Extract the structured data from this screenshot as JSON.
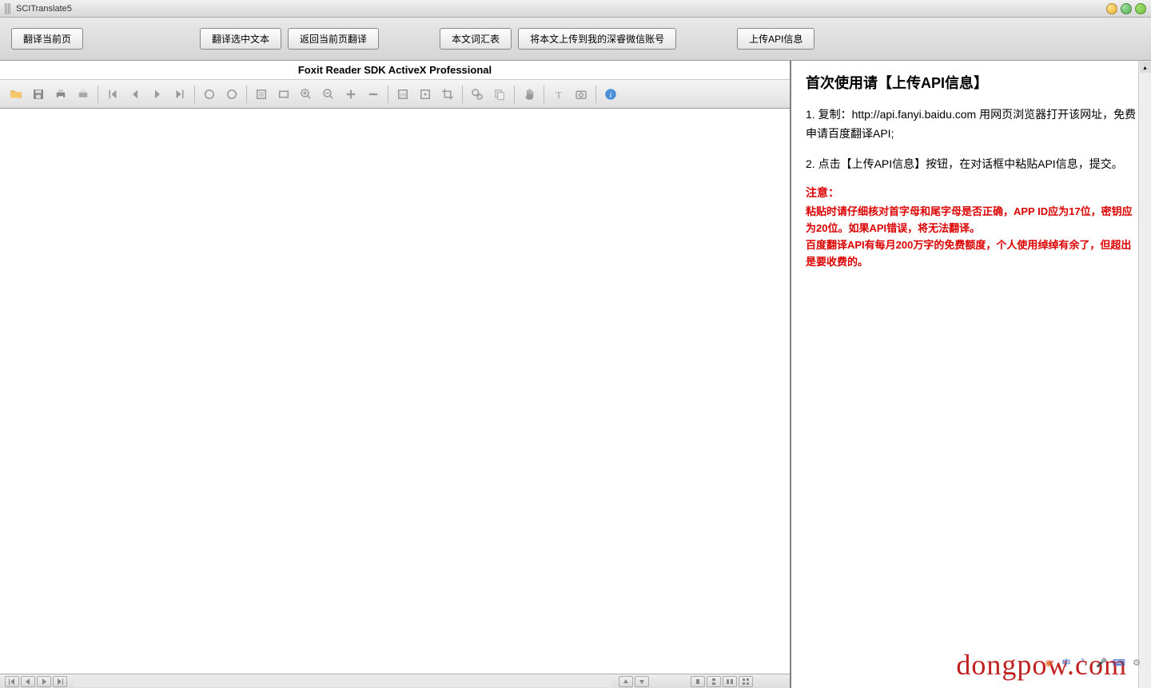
{
  "window": {
    "title": "SCITranslate5"
  },
  "toolbar": {
    "translate_current": "翻译当前页",
    "translate_selected": "翻译选中文本",
    "back_to_translate": "返回当前页翻译",
    "vocabulary": "本文词汇表",
    "upload_wechat": "将本文上传到我的深睿微信账号",
    "upload_api": "上传API信息"
  },
  "foxit": {
    "title": "Foxit Reader SDK ActiveX Professional",
    "icons": {
      "open": "open-icon",
      "save": "save-icon",
      "print": "print-icon",
      "print2": "print2-icon",
      "first": "first-page-icon",
      "prev": "prev-page-icon",
      "next": "next-page-icon",
      "last": "last-page-icon",
      "rotate_l": "rotate-left-icon",
      "rotate_r": "rotate-right-icon",
      "fit_page": "fit-page-icon",
      "fit_width": "fit-width-icon",
      "zoom_in": "zoom-in-icon",
      "zoom_out": "zoom-out-icon",
      "plus": "plus-icon",
      "minus": "minus-icon",
      "actual": "actual-size-icon",
      "fit": "fit-icon",
      "crop": "crop-icon",
      "search": "search-icon",
      "copy": "copy-icon",
      "hand": "hand-icon",
      "text": "text-select-icon",
      "snapshot": "snapshot-icon",
      "about": "about-icon"
    }
  },
  "help": {
    "heading": "首次使用请【上传API信息】",
    "step1": "1. 复制：http://api.fanyi.baidu.com 用网页浏览器打开该网址，免费申请百度翻译API;",
    "step2": "2. 点击【上传API信息】按钮，在对话框中粘贴API信息，提交。",
    "notice_title": "注意：",
    "notice_line1": "粘贴时请仔细核对首字母和尾字母是否正确，APP ID应为17位，密钥应为20位。如果API错误，将无法翻译。",
    "notice_line2": "百度翻译API有每月200万字的免费额度，个人使用绰绰有余了，但超出是要收费的。"
  },
  "watermark": "dongpow.com"
}
